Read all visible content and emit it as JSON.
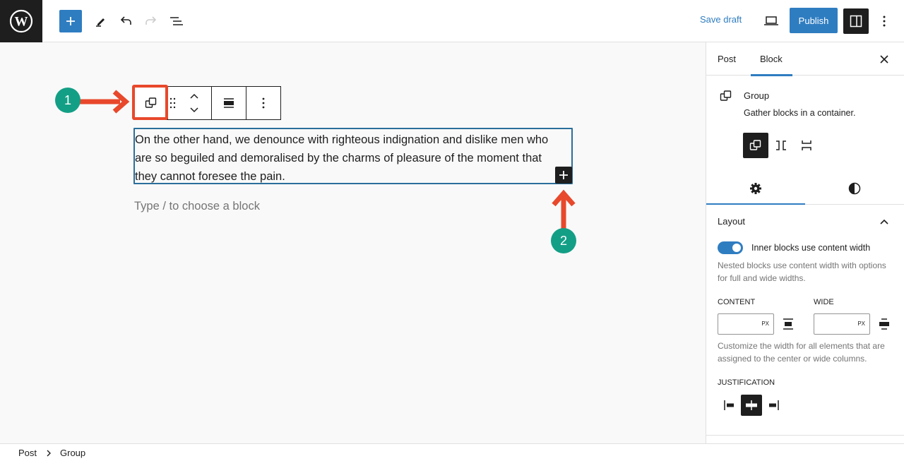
{
  "header": {
    "logo": "wordpress-logo",
    "toolbar_icons": [
      "plus-icon",
      "pencil-icon",
      "undo-icon",
      "redo-icon",
      "list-view-icon"
    ],
    "save_draft_label": "Save draft",
    "publish_label": "Publish",
    "preview_icon": "laptop-icon",
    "settings_icon": "sidebar-panel-icon",
    "more_icon": "vertical-ellipsis-icon"
  },
  "editor": {
    "block_toolbar": {
      "items": [
        "group-icon",
        "drag-handle-icon",
        "move-up-down-icon",
        "align-icon",
        "more-options-icon"
      ]
    },
    "group_text": "On the other hand, we denounce with righteous indignation and dislike men who are so beguiled and demoralised by the charms of pleasure of the moment that they cannot foresee the pain.",
    "placeholder": "Type / to choose a block",
    "annotations": [
      {
        "number": "1",
        "color": "#139f86",
        "arrow_color": "#e8482b"
      },
      {
        "number": "2",
        "color": "#139f86",
        "arrow_color": "#e8482b"
      }
    ]
  },
  "sidebar": {
    "tabs": [
      {
        "label": "Post",
        "active": false
      },
      {
        "label": "Block",
        "active": true
      }
    ],
    "block": {
      "name": "Group",
      "description": "Gather blocks in a container."
    },
    "variations": [
      "group",
      "row",
      "stack"
    ],
    "subtabs": [
      "settings-gear",
      "styles-contrast"
    ],
    "layout": {
      "title": "Layout",
      "toggle_label": "Inner blocks use content width",
      "toggle_on": true,
      "toggle_help": "Nested blocks use content width with options for full and wide widths.",
      "content_label": "CONTENT",
      "content_value": "",
      "wide_label": "WIDE",
      "wide_value": "",
      "unit": "PX",
      "width_help": "Customize the width for all elements that are assigned to the center or wide columns.",
      "justification_label": "JUSTIFICATION",
      "justification_options": [
        "left",
        "center",
        "right"
      ],
      "justification_selected": "center"
    }
  },
  "footer": {
    "breadcrumbs": [
      "Post",
      "Group"
    ]
  },
  "colors": {
    "accent": "#2f7dc1",
    "dark": "#1e1e1e",
    "marker": "#139f86",
    "arrow": "#e8482b"
  }
}
